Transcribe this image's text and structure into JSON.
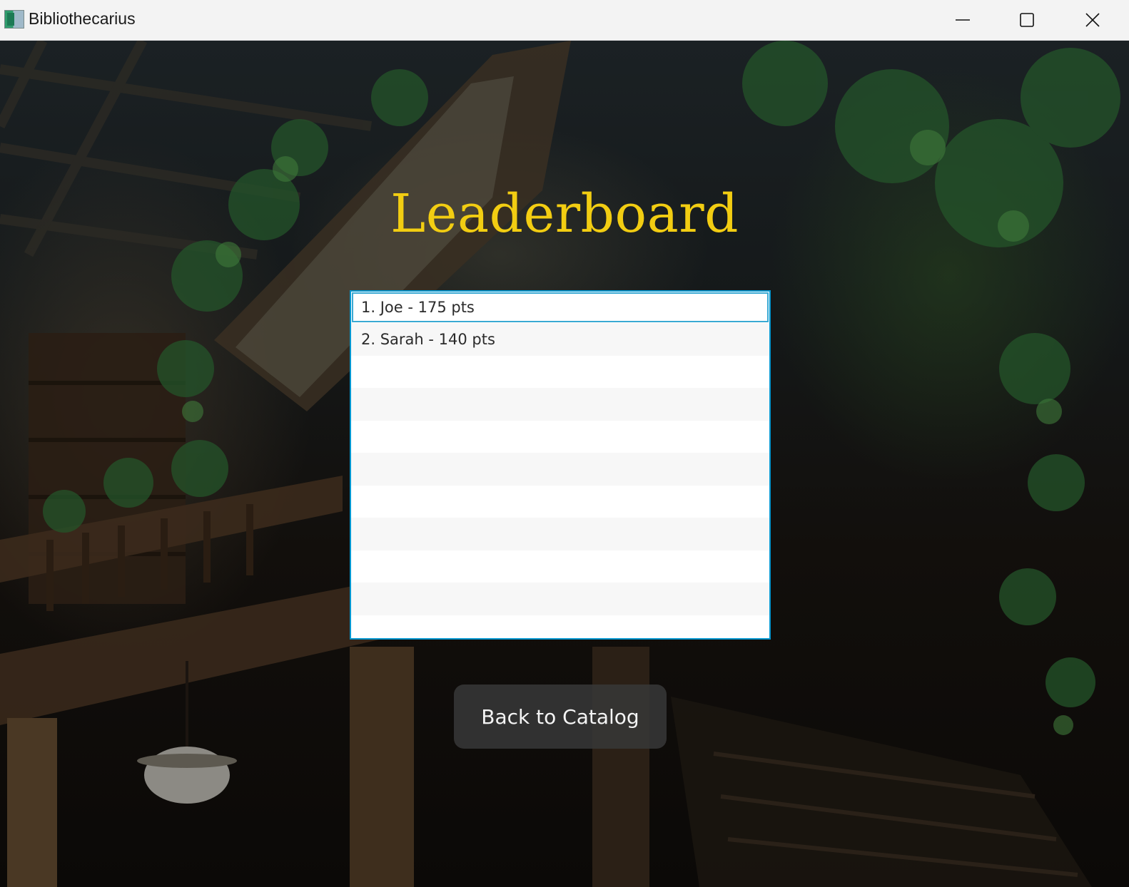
{
  "window": {
    "title": "Bibliothecarius",
    "controls": {
      "minimize_icon": "minimize-icon",
      "maximize_icon": "maximize-icon",
      "close_icon": "close-icon"
    }
  },
  "page": {
    "heading": "Leaderboard",
    "title_color": "#f2cd12"
  },
  "leaderboard": {
    "entries": [
      "1. Joe - 175 pts",
      "2. Sarah - 140 pts"
    ],
    "selected_index": 0,
    "accent_color": "#0596cf"
  },
  "actions": {
    "back_label": "Back to Catalog"
  }
}
